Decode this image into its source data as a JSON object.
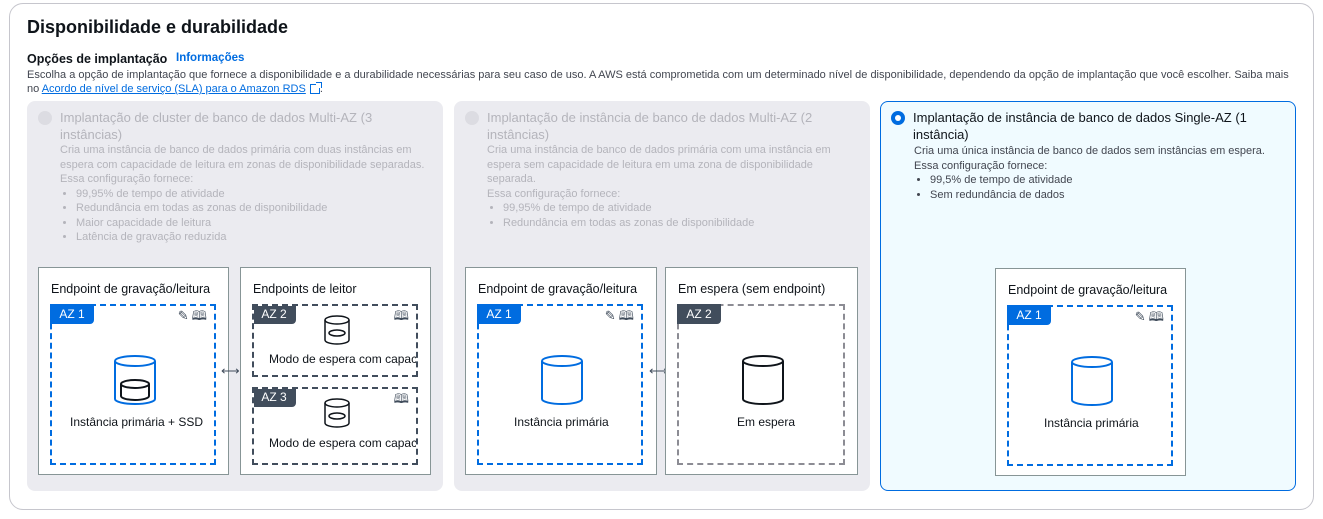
{
  "header": {
    "title": "Disponibilidade e durabilidade",
    "subtitle": "Opções de implantação",
    "info_link": "Informações",
    "description": "Escolha a opção de implantação que fornece a disponibilidade e a durabilidade necessárias para seu caso de uso. A AWS está comprometida com um determinado nível de disponibilidade, dependendo da opção de implantação que você escolher. Saiba mais no",
    "sla_link": "Acordo de nível de serviço (SLA) para o Amazon RDS",
    "description_end": "."
  },
  "options": [
    {
      "title": "Implantação de cluster de banco de dados Multi-AZ (3 instâncias)",
      "description": "Cria uma instância de banco de dados primária com duas instâncias em espera com capacidade de leitura em zonas de disponibilidade separadas.",
      "config_label": "Essa configuração fornece:",
      "bullets": [
        "99,95% de tempo de atividade",
        "Redundância em todas as zonas de disponibilidade",
        "Maior capacidade de leitura",
        "Latência de gravação reduzida"
      ],
      "selected": false,
      "diagram": {
        "left_title": "Endpoint de gravação/leitura",
        "left_az": "AZ 1",
        "left_label": "Instância primária + SSD",
        "right_title": "Endpoints de leitor",
        "az2": "AZ 2",
        "az3": "AZ 3",
        "standby_label": "Modo de espera com capacidade de leitura"
      }
    },
    {
      "title": "Implantação de instância de banco de dados Multi-AZ (2 instâncias)",
      "description": "Cria uma instância de banco de dados primária com uma instância em espera sem capacidade de leitura em uma zona de disponibilidade separada.",
      "config_label": "Essa configuração fornece:",
      "bullets": [
        "99,95% de tempo de atividade",
        "Redundância em todas as zonas de disponibilidade"
      ],
      "selected": false,
      "diagram": {
        "left_title": "Endpoint de gravação/leitura",
        "left_az": "AZ 1",
        "left_label": "Instância primária",
        "right_title": "Em espera (sem endpoint)",
        "az2": "AZ 2",
        "standby_label": "Em espera"
      }
    },
    {
      "title": "Implantação de instância de banco de dados Single-AZ (1 instância)",
      "description": "Cria uma única instância de banco de dados sem instâncias em espera.",
      "config_label": "Essa configuração fornece:",
      "bullets": [
        "99,5% de tempo de atividade",
        "Sem redundância de dados"
      ],
      "selected": true,
      "diagram": {
        "left_title": "Endpoint de gravação/leitura",
        "left_az": "AZ 1",
        "left_label": "Instância primária"
      }
    }
  ],
  "colors": {
    "accent": "#006ce0",
    "disabled_bg": "#ebebf0",
    "selected_bg": "#f0fbff",
    "dark_tag": "#414d5c"
  }
}
